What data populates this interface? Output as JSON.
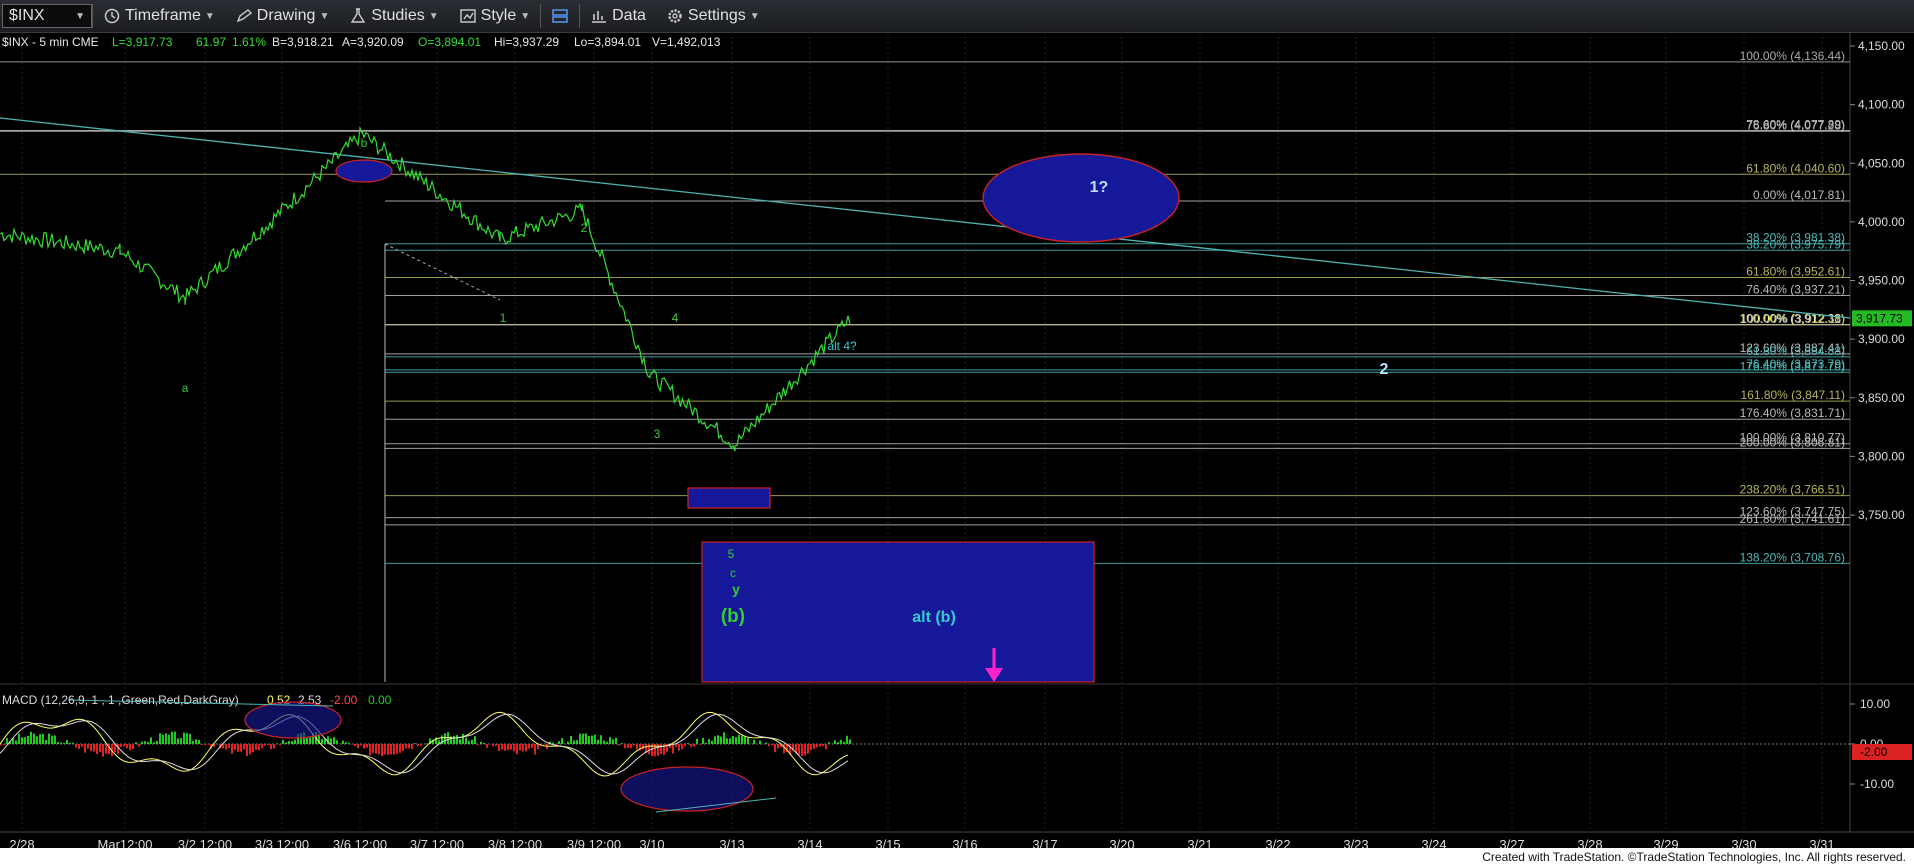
{
  "toolbar": {
    "symbol": "$INX",
    "timeframe": "Timeframe",
    "drawing": "Drawing",
    "studies": "Studies",
    "style": "Style",
    "data": "Data",
    "settings": "Settings"
  },
  "header": {
    "symbol_line": "$INX - 5 min  CME",
    "last": "L=3,917.73",
    "chg": "61.97",
    "pct": "1.61%",
    "bid": "B=3,918.21",
    "ask": "A=3,920.09",
    "open": "O=3,894.01",
    "high": "Hi=3,937.29",
    "low": "Lo=3,894.01",
    "vol": "V=1,492,013"
  },
  "price_axis": {
    "ticks": [
      4150,
      4100,
      4050,
      4000,
      3950,
      3900,
      3850,
      3800,
      3750
    ],
    "tick_labels": [
      "4,150.00",
      "4,100.00",
      "4,050.00",
      "4,000.00",
      "3,950.00",
      "3,900.00",
      "3,850.00",
      "3,800.00",
      "3,750.00"
    ],
    "last_price_label": "3,917.73",
    "ylim": [
      3700,
      4160
    ]
  },
  "fib_levels": [
    {
      "label": "100.00% (4,136.44)",
      "value": 4136.44,
      "color": "#aaaaaa"
    },
    {
      "label": "76.80% (4,077.28)",
      "value": 4077.28,
      "color": "#bbbbbb"
    },
    {
      "label": "78.60% (4,077.89)",
      "value": 4077.89,
      "color": "#bbbbbb"
    },
    {
      "label": "61.80% (4,040.60)",
      "value": 4040.6,
      "color": "#b5b55a"
    },
    {
      "label": "0.00% (4,017.81)",
      "value": 4017.81,
      "color": "#bbbbbb"
    },
    {
      "label": "38.20% (3,981.38)",
      "value": 3981.38,
      "color": "#4db8b8"
    },
    {
      "label": "38.20% (3,975.79)",
      "value": 3975.79,
      "color": "#4db8b8"
    },
    {
      "label": "61.80% (3,952.61)",
      "value": 3952.61,
      "color": "#b5b55a"
    },
    {
      "label": "76.40% (3,937.21)",
      "value": 3937.21,
      "color": "#bbbbbb"
    },
    {
      "label": "100.00% (3,912.38)",
      "value": 3912.38,
      "color": "#ffff66"
    },
    {
      "label": "100.00% (3,912.11)",
      "value": 3912.11,
      "color": "#bbbbbb"
    },
    {
      "label": "123.60% (3,887.41)",
      "value": 3887.41,
      "color": "#bbbbbb"
    },
    {
      "label": "61.80% (3,884.88)",
      "value": 3884.88,
      "color": "#4db8b8"
    },
    {
      "label": "76.40% (3,873.79)",
      "value": 3873.79,
      "color": "#4db8b8"
    },
    {
      "label": "176.40% (3,871.70)",
      "value": 3871.7,
      "color": "#4db8b8"
    },
    {
      "label": "161.80% (3,847.11)",
      "value": 3847.11,
      "color": "#b5b55a"
    },
    {
      "label": "176.40% (3,831.71)",
      "value": 3831.71,
      "color": "#bbbbbb"
    },
    {
      "label": "100.00% (3,810.77)",
      "value": 3810.77,
      "color": "#bbbbbb"
    },
    {
      "label": "200.00% (3,806.81)",
      "value": 3806.81,
      "color": "#bbbbbb"
    },
    {
      "label": "238.20% (3,766.51)",
      "value": 3766.51,
      "color": "#b5b55a"
    },
    {
      "label": "123.60% (3,747.75)",
      "value": 3747.75,
      "color": "#bbbbbb"
    },
    {
      "label": "261.80% (3,741.61)",
      "value": 3741.61,
      "color": "#bbbbbb"
    },
    {
      "label": "138.20% (3,708.76)",
      "value": 3708.76,
      "color": "#4db8b8"
    }
  ],
  "date_axis": {
    "labels": [
      "2/28",
      "Mar12:00",
      "3/2 12:00",
      "3/3 12:00",
      "3/6 12:00",
      "3/7 12:00",
      "3/8 12:00",
      "3/9 12:00",
      "3/10",
      "3/13",
      "3/14",
      "3/15",
      "3/16",
      "3/17",
      "3/20",
      "3/21",
      "3/22",
      "3/23",
      "3/24",
      "3/27",
      "3/28",
      "3/29",
      "3/30",
      "3/31"
    ]
  },
  "wave_labels": [
    {
      "text": "a",
      "color": "#33cc33"
    },
    {
      "text": "b",
      "color": "#33cc33"
    },
    {
      "text": "1",
      "color": "#33cc33"
    },
    {
      "text": "2",
      "color": "#33cc33"
    },
    {
      "text": "3",
      "color": "#33cc33"
    },
    {
      "text": "4",
      "color": "#33cc33"
    },
    {
      "text": "5",
      "color": "#33cc33"
    },
    {
      "text": "c",
      "color": "#33cc33"
    },
    {
      "text": "y",
      "color": "#33cc33"
    },
    {
      "text": "(b)",
      "color": "#33cc33"
    },
    {
      "text": "alt 4?",
      "color": "#33cccc"
    },
    {
      "text": "alt (b)",
      "color": "#33cccc"
    },
    {
      "text": "1?",
      "color": "#bbddff"
    },
    {
      "text": "2",
      "color": "#bbddff"
    }
  ],
  "macd": {
    "header": "MACD (12,26,9, 1 , 1 ,Green,Red,DarkGray)",
    "v1": "0.52",
    "v2": "2.53",
    "v3": "-2.00",
    "v4": "0.00",
    "ticks": [
      "10.00",
      "0.00",
      "-10.00"
    ],
    "last_label": "-2.00"
  },
  "colors": {
    "price_line": "#33dd33",
    "trendline": "#4fb3b3",
    "box_fill": "#16189a",
    "box_border": "#cc2222",
    "macd_up": "#22cc22",
    "macd_down": "#dd2222",
    "arrow": "#ff22cc"
  },
  "chart_data": {
    "type": "line",
    "title": "",
    "xlabel": "",
    "ylabel": "",
    "ylim": [
      3700,
      4160
    ],
    "x": [
      "2/28",
      "3/1",
      "3/2",
      "3/3",
      "3/6",
      "3/7",
      "3/8",
      "3/9",
      "3/10",
      "3/13",
      "3/14"
    ],
    "series": [
      {
        "values": [
          3990,
          3975,
          3935,
          4000,
          4075,
          4030,
          3985,
          4010,
          3870,
          3810,
          3917.73
        ]
      }
    ]
  },
  "footer": "Created with TradeStation. ©TradeStation Technologies, Inc. All rights reserved."
}
